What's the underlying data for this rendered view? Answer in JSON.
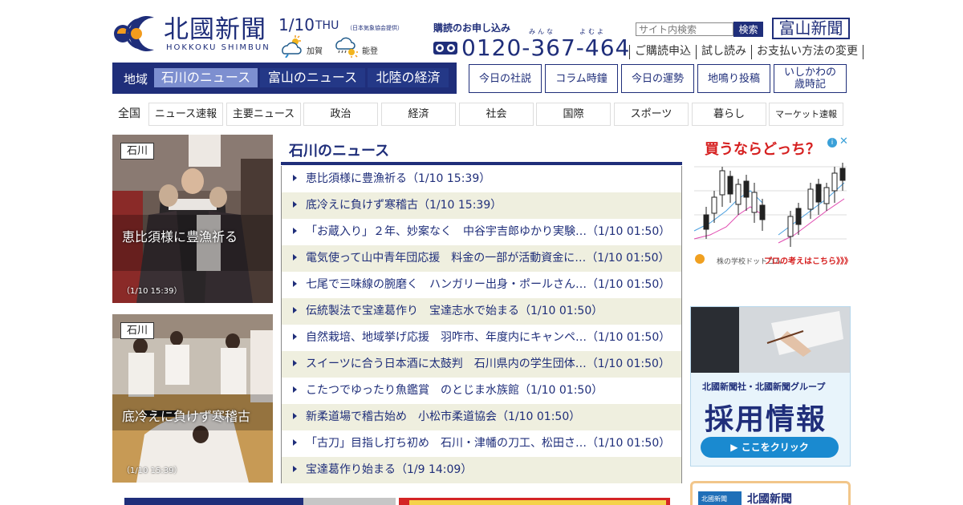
{
  "header": {
    "logo_text": "北國新聞",
    "logo_sub": "HOKKOKU SHIMBUN",
    "date": "1/10",
    "day_of_week": "THU",
    "weather_note_prefix": "（日本気象協会",
    "weather_note_link": "提供",
    "weather_note_suffix": "）",
    "weather": [
      {
        "area": "加賀",
        "icon": "sun-cloud-icon"
      },
      {
        "area": "能登",
        "icon": "cloud-sun-icon"
      }
    ],
    "subscription_label": "購読のお申し込み",
    "phone_ruby_1": "みんな",
    "phone_ruby_2": "よむよ",
    "phone_number": "0120-367-464",
    "search_placeholder": "サイト内検索",
    "search_button": "検索",
    "toyama_logo": "富山新聞",
    "util_links": [
      "ご購読申込",
      "試し読み",
      "お支払い方法の変更"
    ]
  },
  "region_nav": {
    "label": "地域",
    "tabs": [
      "石川のニュース",
      "富山のニュース",
      "北陸の経済"
    ],
    "active_index": 0
  },
  "feature_links": [
    "今日の社説",
    "コラム時鐘",
    "今日の運勢",
    "地鳴り投稿",
    "いしかわの\n歳時記"
  ],
  "category_nav": {
    "all": "全国",
    "items": [
      "ニュース速報",
      "主要ニュース",
      "政治",
      "経済",
      "社会",
      "国際",
      "スポーツ",
      "暮らし",
      "マーケット速報"
    ]
  },
  "photo_cards": [
    {
      "tag": "石川",
      "caption": "恵比須様に豊漁祈る",
      "timestamp": "（1/10 15:39）"
    },
    {
      "tag": "石川",
      "caption": "底冷えに負けず寒稽古",
      "timestamp": "（1/10 15:39）"
    }
  ],
  "news": {
    "title": "石川のニュース",
    "items": [
      "恵比須様に豊漁祈る（1/10 15:39）",
      "底冷えに負けず寒稽古（1/10 15:39）",
      "「お蔵入り」２年、妙案なく　中谷宇吉郎ゆかり実験…（1/10 01:50）",
      "電気使って山中青年団応援　料金の一部が活動資金に…（1/10 01:50）",
      "七尾で三味線の腕磨く　ハンガリー出身・ポールさん…（1/10 01:50）",
      "伝統製法で宝達葛作り　宝達志水で始まる（1/10 01:50）",
      "自然栽培、地域挙げ応援　羽咋市、年度内にキャンペ…（1/10 01:50）",
      "スイーツに合う日本酒に太鼓判　石川県内の学生団体…（1/10 01:50）",
      "こたつでゆったり魚鑑賞　のとじま水族館（1/10 01:50）",
      "新柔道場で稽古始め　小松市柔道協会（1/10 01:50）",
      "「古刀」目指し打ち初め　石川・津幡の刀工、松田さ…（1/10 01:50）",
      "宝達葛作り始まる（1/9 14:09）"
    ]
  },
  "ads": {
    "stock_title": "買うならどっち？",
    "stock_info": "i",
    "stock_close": "✕",
    "stock_footer": "株の学校ドットコム",
    "stock_cta": "プロの考えはこちら》》》",
    "recruit_org": "北國新聞社・北國新聞グループ",
    "recruit_title": "採用情報",
    "recruit_button": "▶ ここをクリック",
    "promo_thumb": "北國新聞",
    "promo_name": "北國新聞"
  },
  "colors": {
    "brand_navy": "#1f2e7a",
    "active_tab": "#7d8fd0",
    "row_alt": "#efefdf"
  }
}
